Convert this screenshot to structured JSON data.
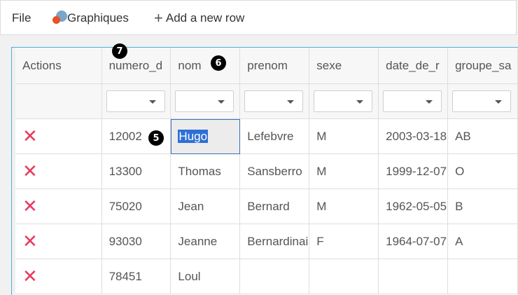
{
  "menubar": {
    "file_label": "File",
    "graphiques_label": "Graphiques",
    "add_row_label": "Add a new row"
  },
  "grid": {
    "columns": [
      "Actions",
      "numero_d",
      "nom",
      "prenom",
      "sexe",
      "date_de_r",
      "groupe_sa"
    ],
    "rows": [
      {
        "numero": "12002",
        "nom": "Hugo",
        "prenom": "Lefebvre",
        "sexe": "M",
        "date": "2003-03-18",
        "groupe": "AB"
      },
      {
        "numero": "13300",
        "nom": "Thomas",
        "prenom": "Sansberro",
        "sexe": "M",
        "date": "1999-12-07",
        "groupe": "O"
      },
      {
        "numero": "75020",
        "nom": "Jean",
        "prenom": "Bernard",
        "sexe": "M",
        "date": "1962-05-05",
        "groupe": "B"
      },
      {
        "numero": "93030",
        "nom": "Jeanne",
        "prenom": "Bernardinai",
        "sexe": "F",
        "date": "1964-07-07",
        "groupe": "A"
      },
      {
        "numero": "78451",
        "nom": "Loul",
        "prenom": "",
        "sexe": "",
        "date": "",
        "groupe": ""
      }
    ],
    "delete_glyph": "✕"
  },
  "badges": {
    "b7": "7",
    "b6": "6",
    "b5": "5"
  },
  "colors": {
    "accent_border": "#4bb3d6",
    "delete_red": "#e83a5e",
    "selection": "#2f6fd6"
  }
}
